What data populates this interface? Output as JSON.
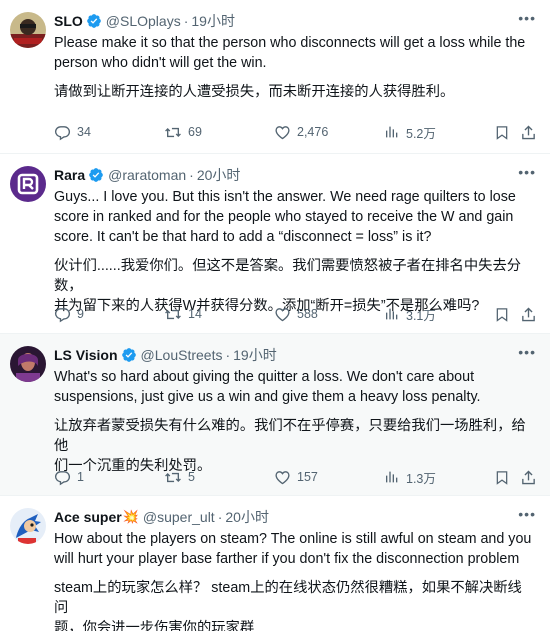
{
  "tweets": [
    {
      "name": "SLO",
      "handle": "@SLOplays",
      "time": "19小时",
      "text": "Please make it so that the person who disconnects will get a loss while the\nperson who didn't will get the win.",
      "translation": "请做到让断开连接的人遭受损失，而未断开连接的人获得胜利。",
      "replies": "34",
      "retweets": "69",
      "likes": "2,476",
      "views": "5.2万"
    },
    {
      "name": "Rara",
      "handle": "@raratoman",
      "time": "20小时",
      "text": "Guys... I love you. But this isn't the answer. We need rage quilters to lose\nscore in ranked and for the people who stayed to receive the W and gain\nscore. It can't be that hard to add a “disconnect = loss” is it?",
      "translation": "伙计们......我爱你们。但这不是答案。我们需要愤怒被子者在排名中失去分数，\n并为留下来的人获得W并获得分数。添加“断开=损失”不是那么难吗?",
      "replies": "9",
      "retweets": "14",
      "likes": "588",
      "views": "3.1万"
    },
    {
      "name": "LS Vision",
      "handle": "@LouStreets",
      "time": "19小时",
      "text": "What's so hard about giving the quitter a loss. We don't care about\nsuspensions, just give us a win and give them a heavy loss penalty.",
      "translation": "让放弃者蒙受损失有什么难的。我们不在乎停赛，只要给我们一场胜利，给他\n们一个沉重的失利处罚。",
      "replies": "1",
      "retweets": "5",
      "likes": "157",
      "views": "1.3万"
    },
    {
      "name": "Ace super",
      "handle": "@super_ult",
      "time": "20小时",
      "text": "How about the players on steam? The online is still awful on steam and you\nwill hurt your player base farther if you don't fix the disconnection problem",
      "translation": "steam上的玩家怎么样？ steam上的在线状态仍然很糟糕，如果不解决断线问\n题，你会进一步伤害你的玩家群"
    }
  ],
  "name_emoji": "💥",
  "colors": {
    "text": "#0f1419",
    "secondary": "#536471",
    "verified": "#1d9bf0",
    "divider": "#eff3f4",
    "highlight_bg": "#f7f9f9"
  },
  "icons": [
    "verified-badge-icon",
    "more-icon",
    "reply-icon",
    "retweet-icon",
    "like-icon",
    "views-icon",
    "bookmark-icon",
    "share-icon"
  ]
}
